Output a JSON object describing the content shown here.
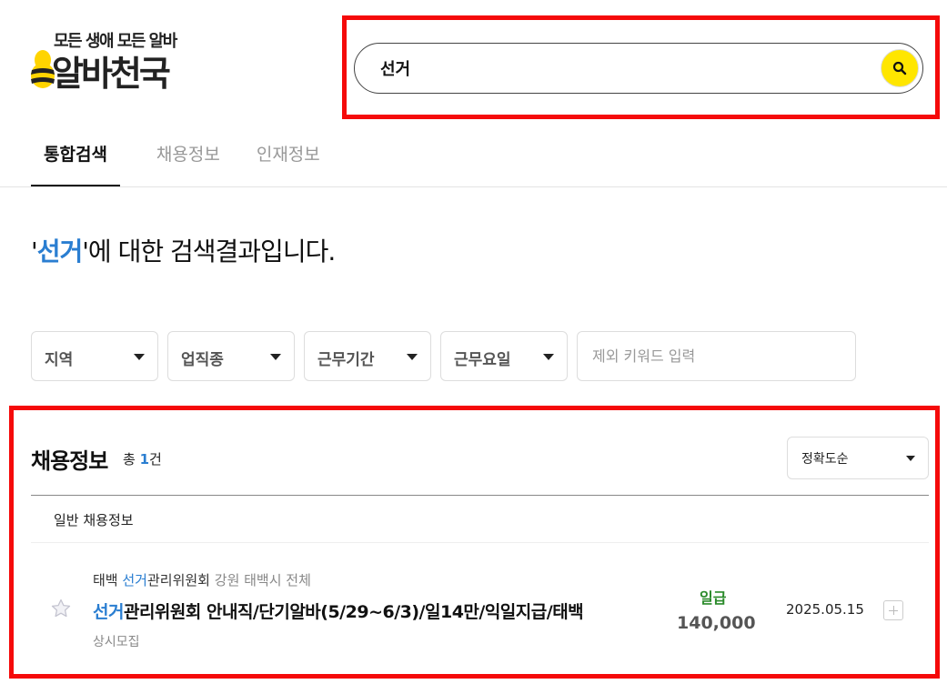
{
  "logo": {
    "tagline": "모든 생애 모든 알바",
    "brand": "알바천국"
  },
  "search": {
    "value": "선거",
    "button_icon": "search-icon"
  },
  "tabs": [
    {
      "label": "통합검색",
      "active": true
    },
    {
      "label": "채용정보",
      "active": false
    },
    {
      "label": "인재정보",
      "active": false
    }
  ],
  "heading": {
    "quote_open": "'",
    "keyword": "선거",
    "suffix": "'에 대한 검색결과입니다."
  },
  "filters": [
    {
      "label": "지역"
    },
    {
      "label": "업직종"
    },
    {
      "label": "근무기간"
    },
    {
      "label": "근무요일"
    }
  ],
  "exclude_keyword": {
    "placeholder": "제외 키워드 입력"
  },
  "results": {
    "section_title": "채용정보",
    "count_prefix": "총 ",
    "count": "1",
    "count_suffix": "건",
    "sort_label": "정확도순",
    "subheader": "일반 채용정보",
    "items": [
      {
        "company_pre": "태백 ",
        "company_kw": "선거",
        "company_post": "관리위원회",
        "location": " 강원 태백시 전체",
        "title_kw": "선거",
        "title_rest": "관리위원회 안내직/단기알바(5/29~6/3)/일14만/익일지급/태백",
        "period": "상시모집",
        "pay_type": "일급",
        "pay_amount": "140,000",
        "date": "2025.05.15"
      }
    ]
  },
  "colors": {
    "accent_blue": "#2a7ed1",
    "search_button": "#ffe600",
    "highlight_red": "#f50a0a",
    "pay_green": "#2a8a2a"
  }
}
